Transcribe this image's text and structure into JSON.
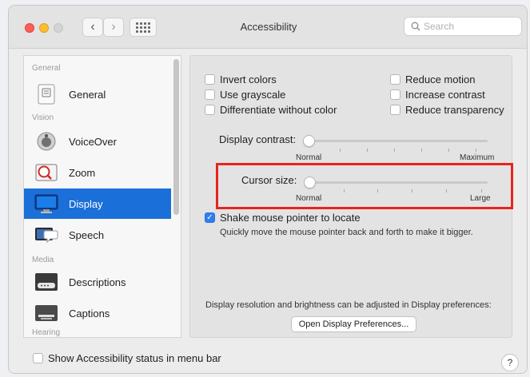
{
  "window": {
    "title": "Accessibility"
  },
  "search": {
    "placeholder": "Search"
  },
  "sidebar": {
    "groups": {
      "general": "General",
      "vision": "Vision",
      "media": "Media",
      "hearing": "Hearing"
    },
    "items": [
      {
        "label": "General",
        "icon": "general-icon"
      },
      {
        "label": "VoiceOver",
        "icon": "voiceover-icon"
      },
      {
        "label": "Zoom",
        "icon": "zoom-icon"
      },
      {
        "label": "Display",
        "icon": "display-icon",
        "selected": true
      },
      {
        "label": "Speech",
        "icon": "speech-icon"
      },
      {
        "label": "Descriptions",
        "icon": "descriptions-icon"
      },
      {
        "label": "Captions",
        "icon": "captions-icon"
      }
    ]
  },
  "display": {
    "options_left": [
      {
        "label": "Invert colors",
        "checked": false
      },
      {
        "label": "Use grayscale",
        "checked": false
      },
      {
        "label": "Differentiate without color",
        "checked": false
      }
    ],
    "options_right": [
      {
        "label": "Reduce motion",
        "checked": false
      },
      {
        "label": "Increase contrast",
        "checked": false
      },
      {
        "label": "Reduce transparency",
        "checked": false
      }
    ],
    "contrast": {
      "label": "Display contrast:",
      "min_label": "Normal",
      "max_label": "Maximum",
      "value": 0
    },
    "cursor": {
      "label": "Cursor size:",
      "min_label": "Normal",
      "max_label": "Large",
      "value": 0
    },
    "shake": {
      "label": "Shake mouse pointer to locate",
      "checked": true,
      "description": "Quickly move the mouse pointer back and forth to make it bigger."
    },
    "footer_note": "Display resolution and brightness can be adjusted in Display preferences:",
    "open_button": "Open Display Preferences..."
  },
  "bottom": {
    "status_label": "Show Accessibility status in menu bar",
    "status_checked": false,
    "help": "?"
  },
  "colors": {
    "accent": "#1b6fd8",
    "checkbox": "#2f7ef0",
    "highlight": "#e8241d"
  }
}
